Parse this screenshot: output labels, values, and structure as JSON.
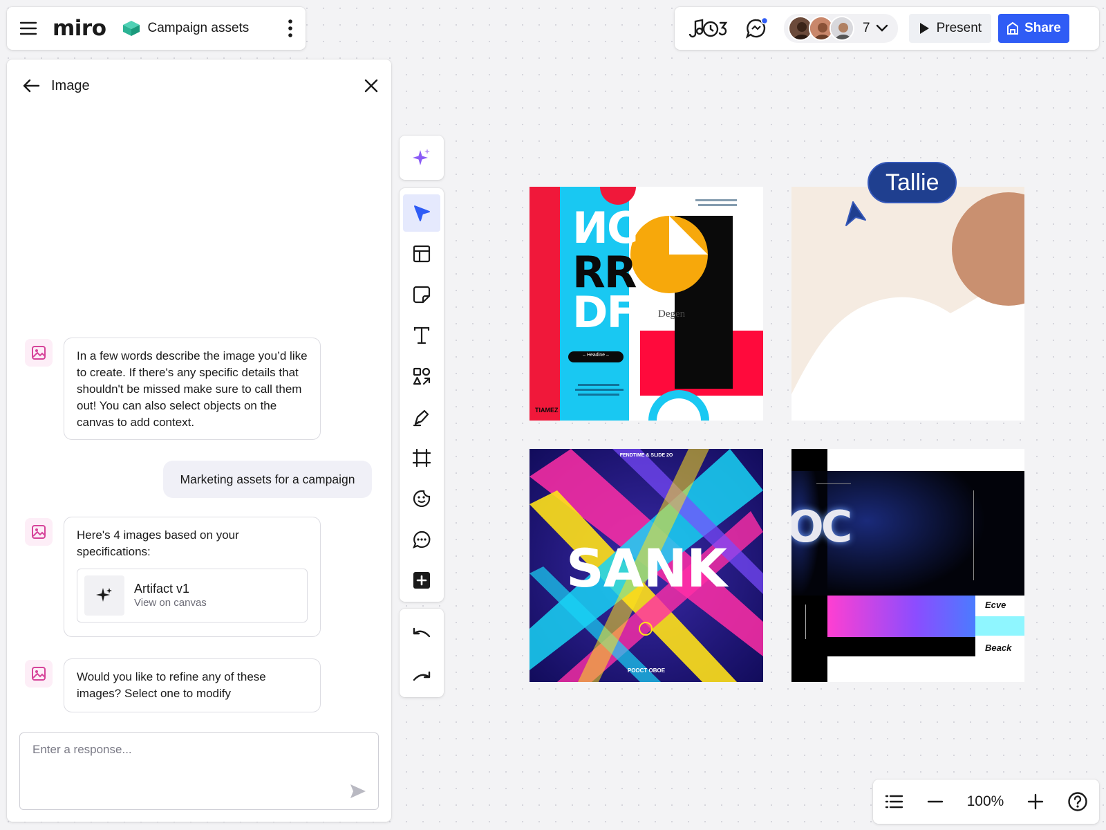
{
  "header": {
    "logo": "miro",
    "board_title": "Campaign assets"
  },
  "collaborators": {
    "count": "7"
  },
  "actions": {
    "present_label": "Present",
    "share_label": "Share"
  },
  "panel": {
    "title": "Image",
    "messages": {
      "intro": "In a few words describe the image you’d like to create. If there's any specific details that shouldn't be missed make sure to call them  out! You can also select objects on the canvas to add context.",
      "user": "Marketing assets for a campaign",
      "result": "Here's 4 images based on your specifications:",
      "refine": "Would you like to refine any of these images? Select one to modify"
    },
    "artifact": {
      "title": "Artifact v1",
      "subtitle": "View on canvas"
    },
    "response_placeholder": "Enter a response..."
  },
  "canvas": {
    "cursor_name": "Tallie",
    "art1": {
      "line1": "ИC",
      "line2": "RR",
      "line3": "DF",
      "button": "– Headine –",
      "side": "Degen",
      "brand": "TIAMEZ"
    },
    "art3": {
      "word": "SANK",
      "top": "FENDTIME & SLIDE 2O",
      "bottom": "POOCT OBOE"
    },
    "art4": {
      "letters": "OC",
      "label1": "Ecve",
      "label2": "Beack"
    }
  },
  "zoom": {
    "level": "100%"
  },
  "colors": {
    "accent": "#2f5cf5",
    "cursor": "#1f3f8f",
    "ai_purple": "#8b5cf6"
  }
}
